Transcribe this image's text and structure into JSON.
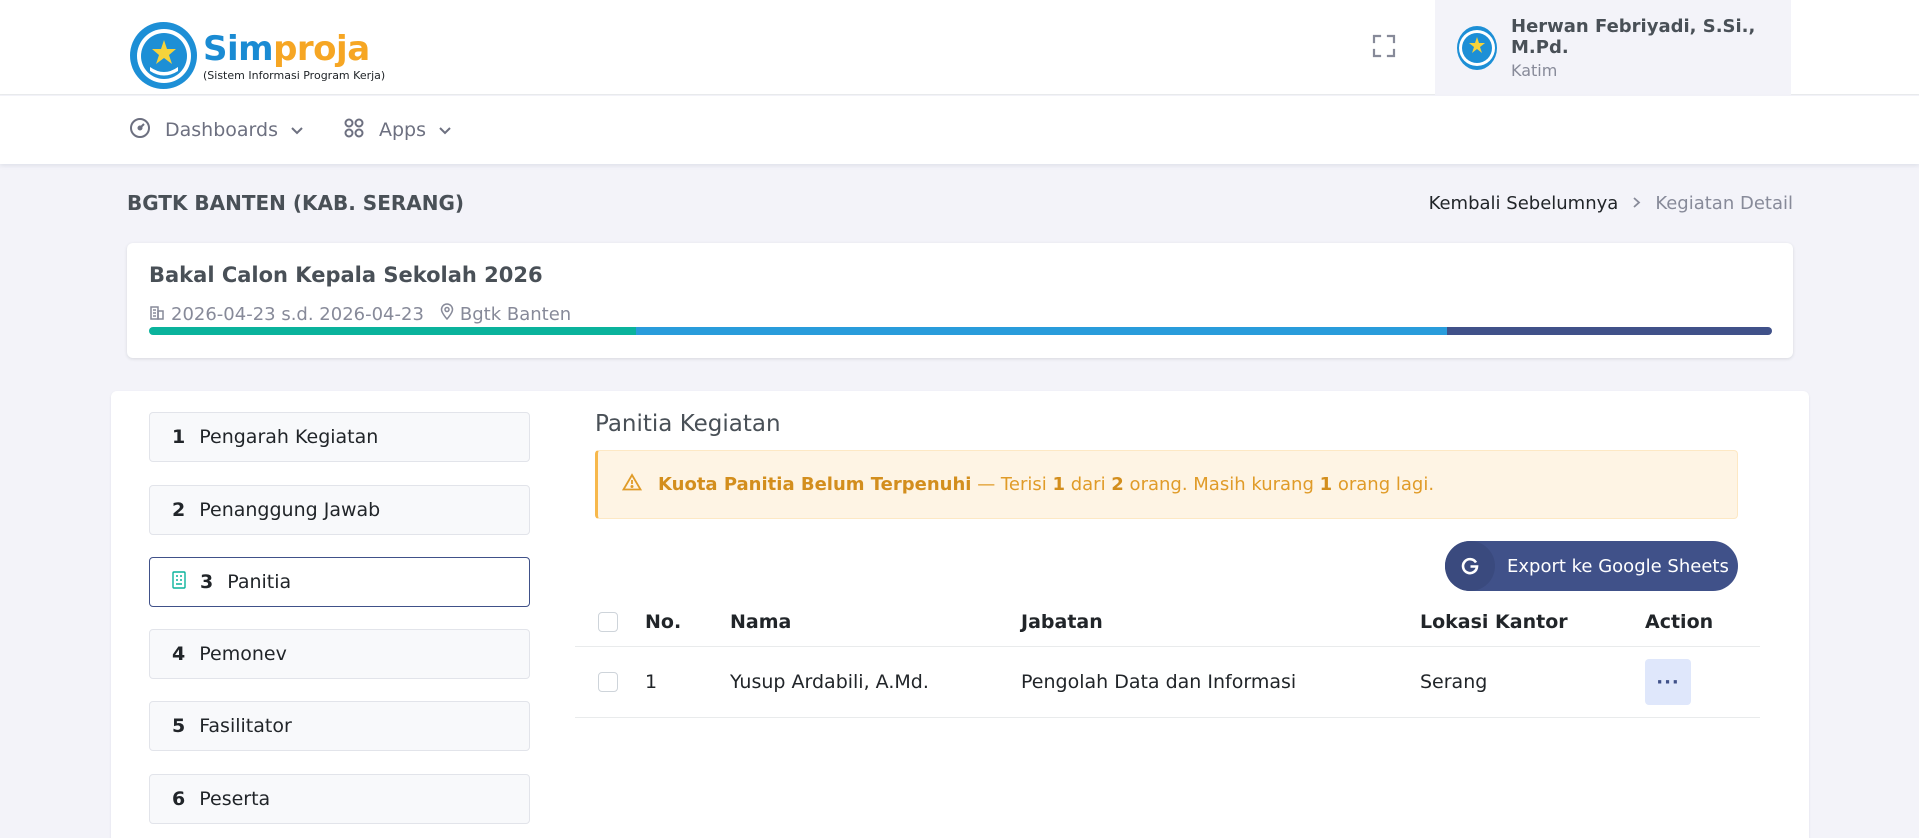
{
  "header": {
    "logo_title_part1": "Sim",
    "logo_title_part2": "proja",
    "logo_subtitle": "(Sistem Informasi Program Kerja)",
    "user_name": "Herwan Febriyadi, S.Si., M.Pd.",
    "user_role": "Katim"
  },
  "nav": {
    "dashboards": "Dashboards",
    "apps": "Apps"
  },
  "page": {
    "title": "BGTK BANTEN (KAB. SERANG)",
    "breadcrumb_back": "Kembali Sebelumnya",
    "breadcrumb_current": "Kegiatan Detail"
  },
  "event": {
    "title": "Bakal Calon Kepala Sekolah 2026",
    "date_range": "2026-04-23 s.d. 2026-04-23",
    "location": "Bgtk Banten",
    "progress_segments": [
      {
        "fraction": 0.3,
        "color": "#0ab39c"
      },
      {
        "fraction": 0.5,
        "color": "#299cdb"
      },
      {
        "fraction": 0.2,
        "color": "#405189"
      }
    ]
  },
  "steps": [
    {
      "num": "1",
      "label": "Pengarah Kegiatan",
      "active": false
    },
    {
      "num": "2",
      "label": "Penanggung Jawab",
      "active": false
    },
    {
      "num": "3",
      "label": "Panitia",
      "active": true
    },
    {
      "num": "4",
      "label": "Pemonev",
      "active": false
    },
    {
      "num": "5",
      "label": "Fasilitator",
      "active": false
    },
    {
      "num": "6",
      "label": "Peserta",
      "active": false
    }
  ],
  "section": {
    "title": "Panitia Kegiatan",
    "alert_title": "Kuota Panitia Belum Terpenuhi",
    "alert_t1": " — Terisi ",
    "alert_n1": "1",
    "alert_t2": " dari ",
    "alert_n2": "2",
    "alert_t3": " orang. Masih kurang ",
    "alert_n3": "1",
    "alert_t4": " orang lagi.",
    "export_label": "Export ke Google Sheets"
  },
  "table": {
    "headers": {
      "no": "No.",
      "nama": "Nama",
      "jabatan": "Jabatan",
      "lokasi": "Lokasi Kantor",
      "action": "Action"
    },
    "rows": [
      {
        "no": "1",
        "nama": "Yusup Ardabili, A.Md.",
        "jabatan": "Pengolah Data dan Informasi",
        "lokasi": "Serang",
        "action": "···"
      }
    ]
  }
}
